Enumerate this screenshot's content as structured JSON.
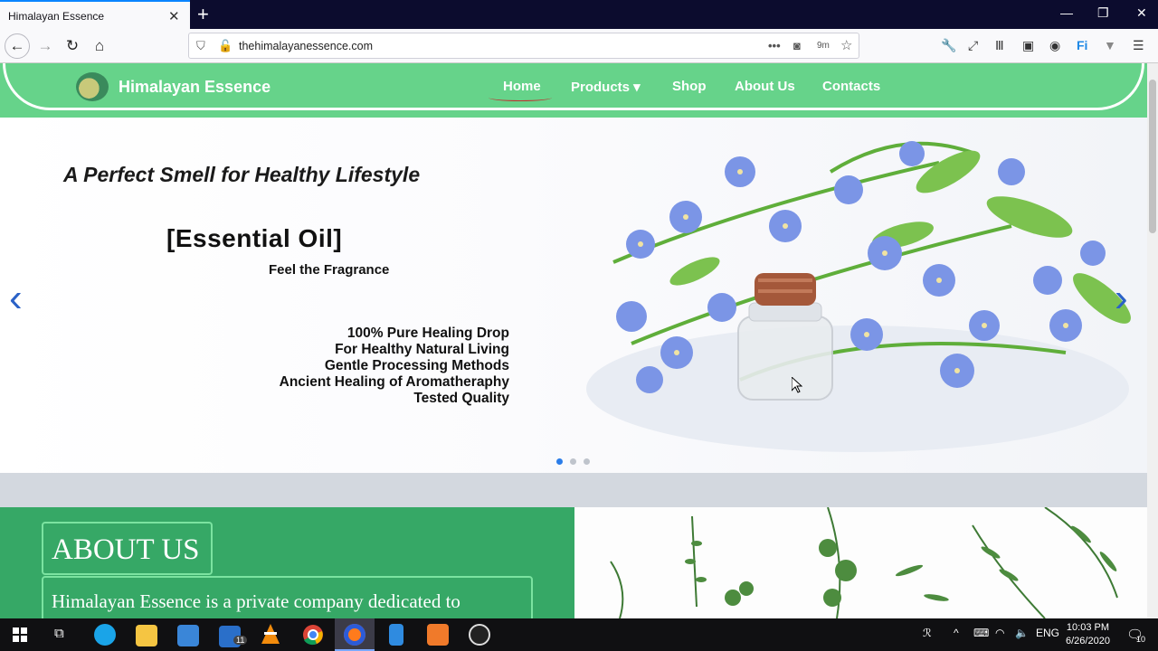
{
  "browser": {
    "tab_title": "Himalayan Essence",
    "url": "thehimalayanessence.com",
    "addon_badge": "9m"
  },
  "site": {
    "brand": "Himalayan Essence",
    "menu": [
      {
        "label": "Home"
      },
      {
        "label": "Products ▾"
      },
      {
        "label": "Shop"
      },
      {
        "label": "About Us"
      },
      {
        "label": "Contacts"
      }
    ]
  },
  "hero": {
    "headline": "A Perfect Smell for Healthy Lifestyle",
    "product": "[Essential Oil]",
    "tagline": "Feel the Fragrance",
    "features": [
      "100% Pure Healing Drop",
      "For Healthy Natural Living",
      "Gentle Processing Methods",
      "Ancient Healing of Aromatheraphy",
      "Tested Quality"
    ],
    "slide_count": 3,
    "active_slide": 1
  },
  "about": {
    "title": "ABOUT US",
    "text": "Himalayan Essence is a private company dedicated to"
  },
  "taskbar": {
    "language": "ENG",
    "time": "10:03 PM",
    "date": "6/26/2020",
    "mail_badge": "11",
    "notification_badge": "10"
  },
  "colors": {
    "header_green": "#66d38a",
    "about_green": "#36a866",
    "arrow_blue": "#2b62c7"
  }
}
